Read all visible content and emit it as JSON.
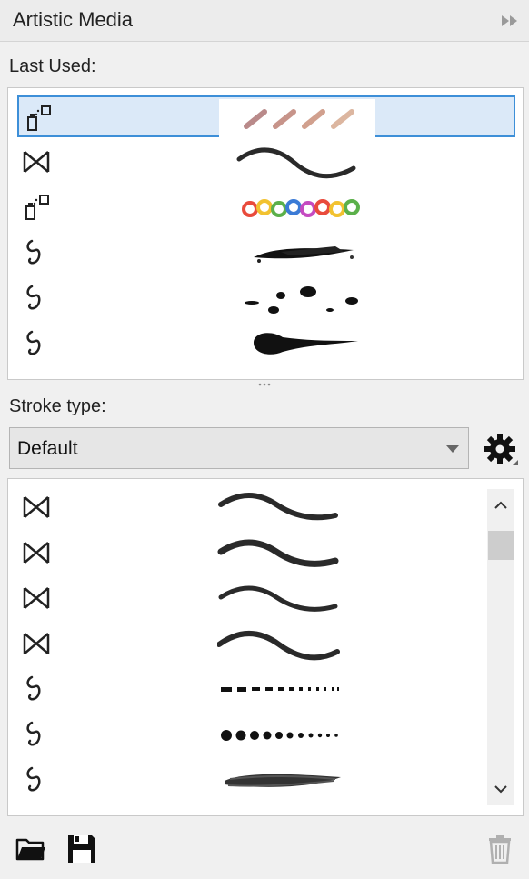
{
  "panel": {
    "title": "Artistic Media"
  },
  "last_used": {
    "label": "Last Used:",
    "items": [
      {
        "type_icon": "sprayer-icon",
        "preview": "brush-strokes-preview",
        "selected": true
      },
      {
        "type_icon": "preset-icon",
        "preview": "wave-stroke-preview",
        "selected": false
      },
      {
        "type_icon": "sprayer-icon",
        "preview": "colorful-swirls-preview",
        "selected": false
      },
      {
        "type_icon": "calligraphic-icon",
        "preview": "grunge-stroke-preview",
        "selected": false
      },
      {
        "type_icon": "calligraphic-icon",
        "preview": "splatter-preview",
        "selected": false
      },
      {
        "type_icon": "calligraphic-icon",
        "preview": "teardrop-stroke-preview",
        "selected": false
      }
    ]
  },
  "stroke_type": {
    "label": "Stroke type:",
    "selected": "Default",
    "settings_icon": "gear-icon"
  },
  "strokes": {
    "items": [
      {
        "type_icon": "preset-icon",
        "preview": "wave-stroke-1"
      },
      {
        "type_icon": "preset-icon",
        "preview": "wave-stroke-2"
      },
      {
        "type_icon": "preset-icon",
        "preview": "wave-stroke-3"
      },
      {
        "type_icon": "preset-icon",
        "preview": "wave-stroke-4"
      },
      {
        "type_icon": "calligraphic-icon",
        "preview": "dashed-stroke"
      },
      {
        "type_icon": "calligraphic-icon",
        "preview": "dotted-stroke"
      },
      {
        "type_icon": "calligraphic-icon",
        "preview": "charcoal-stroke"
      }
    ],
    "scroll_position": 0.05
  },
  "footer": {
    "open_icon": "folder-open-icon",
    "save_icon": "save-icon",
    "delete_icon": "trash-icon",
    "delete_enabled": false
  },
  "colors": {
    "selection": "#dbe9f8",
    "selection_border": "#3d8fd8",
    "panel_bg": "#f0f0f0"
  }
}
